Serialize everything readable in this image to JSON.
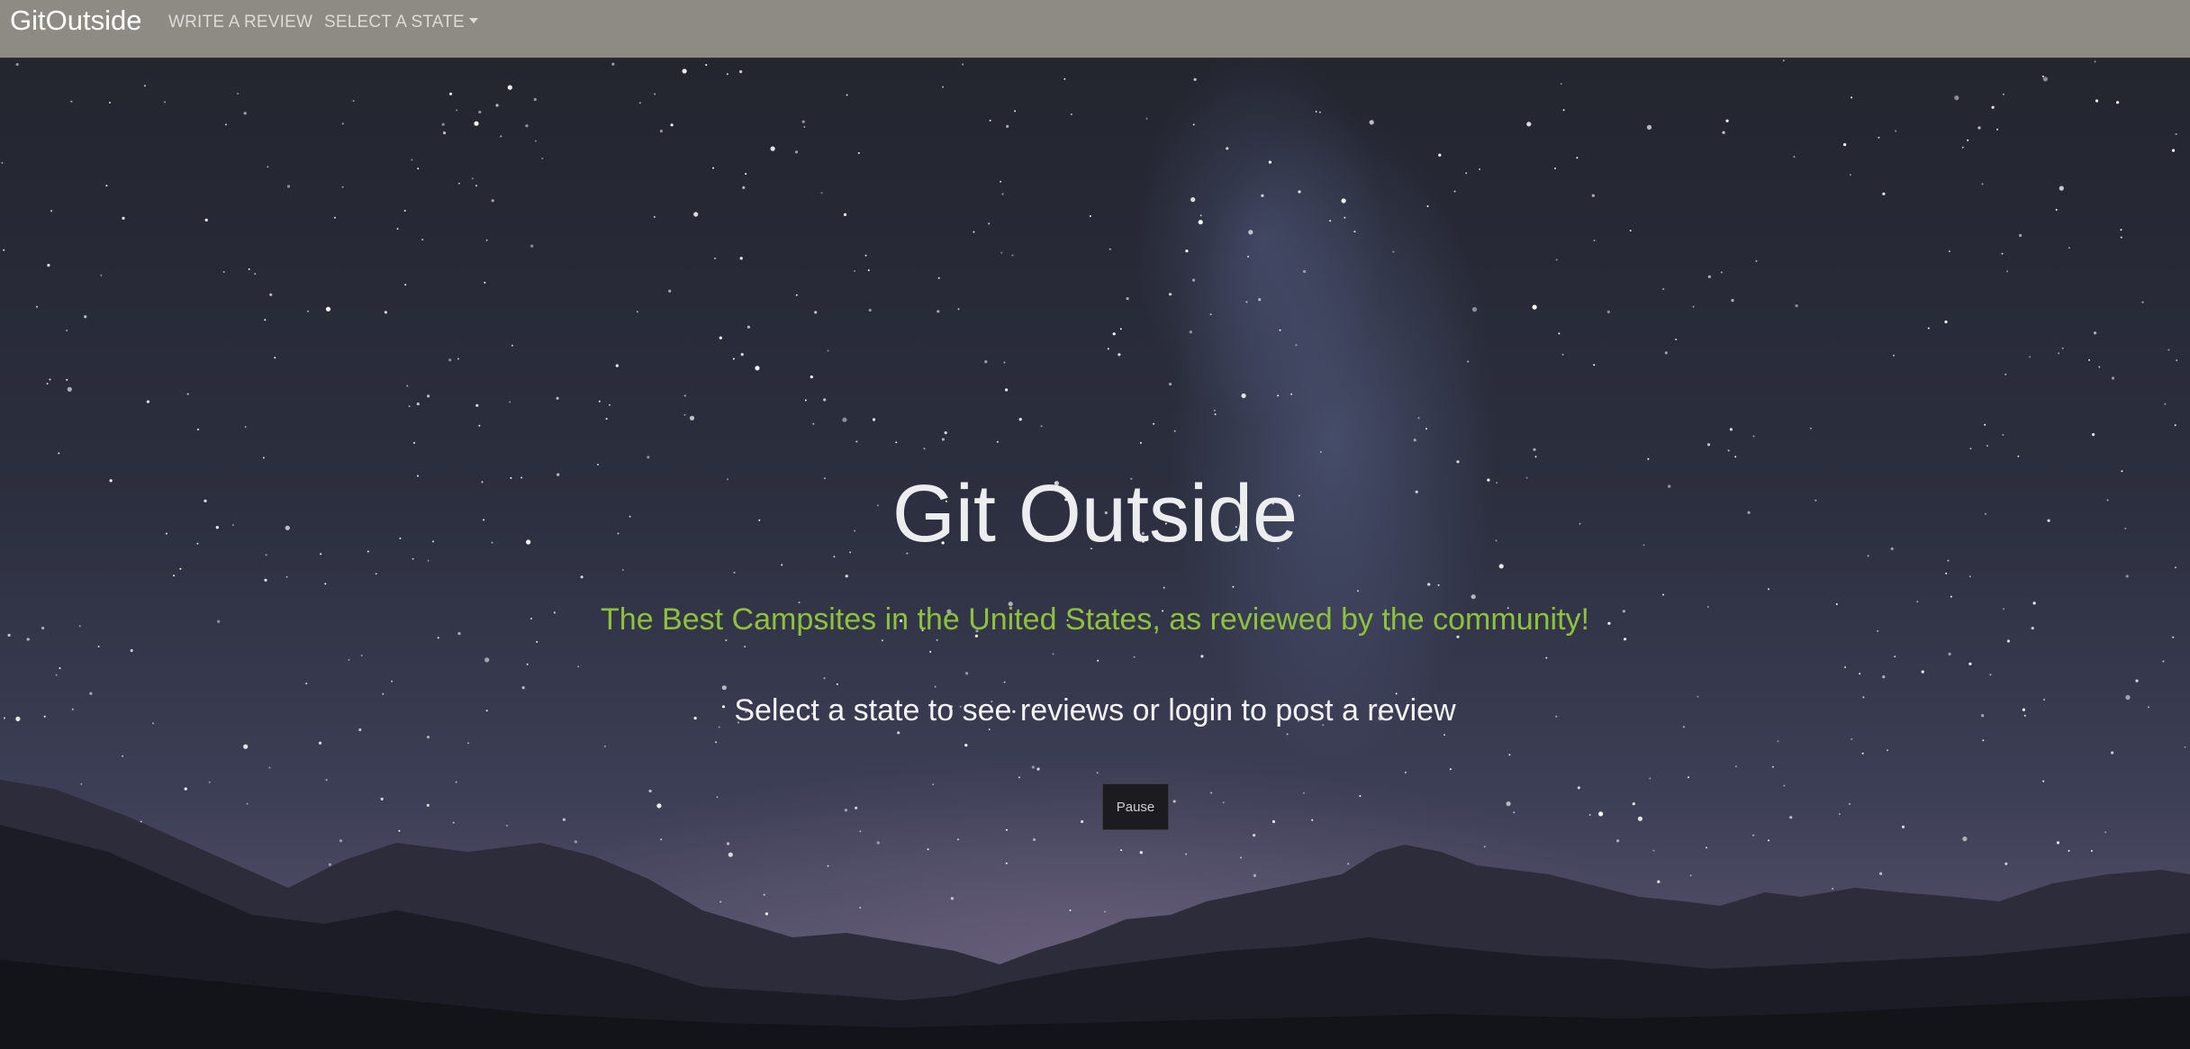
{
  "navbar": {
    "brand": "GitOutside",
    "write_review": "WRITE A REVIEW",
    "select_state": "SELECT A STATE",
    "select_state_icon": "caret-down-icon"
  },
  "hero": {
    "title": "Git Outside",
    "tagline": "The Best Campsites in the United States, as reviewed by the community!",
    "instructions": "Select a state to see reviews or login to post a review",
    "pause_label": "Pause",
    "background": "starry-night-mountains-video"
  },
  "colors": {
    "navbar_bg": "#8e8b85",
    "tagline": "#8fc13d",
    "title": "#ecedef",
    "button_bg": "#1c1c20"
  }
}
